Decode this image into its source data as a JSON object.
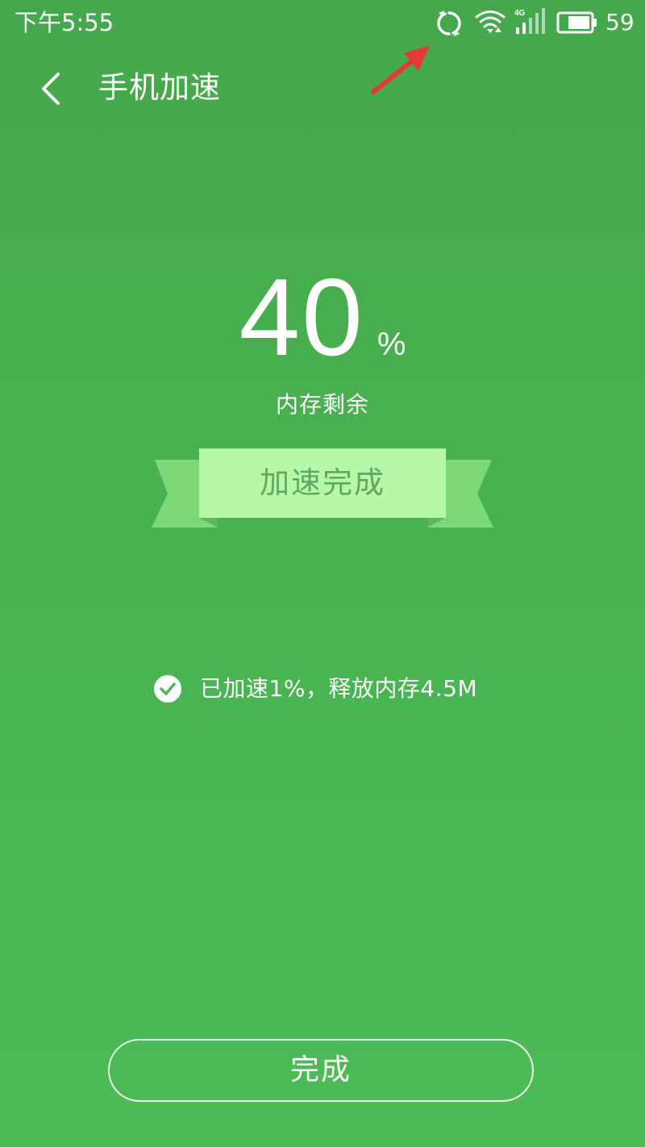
{
  "status_bar": {
    "time": "下午5:55",
    "network_type": "4G",
    "battery_level": "59",
    "icons": [
      "sync-icon",
      "wifi-icon",
      "signal-icon",
      "battery-icon"
    ]
  },
  "header": {
    "back_icon": "chevron-left-icon",
    "title": "手机加速"
  },
  "memory": {
    "value": "40",
    "unit": "%",
    "caption": "内存剩余"
  },
  "banner": {
    "label": "加速完成"
  },
  "result": {
    "icon": "check-circle-icon",
    "text": "已加速1%，释放内存4.5M"
  },
  "footer": {
    "done_label": "完成"
  },
  "colors": {
    "background_top": "#46a84c",
    "background_bottom": "#4cbc56",
    "ribbon_center": "#b6f7a8",
    "ribbon_wing": "#7dd877",
    "ribbon_text": "#5ea962",
    "annotation_arrow": "#e53935"
  }
}
